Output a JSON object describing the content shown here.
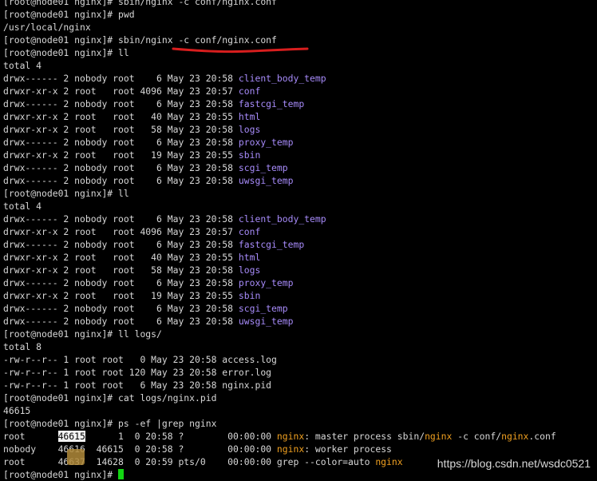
{
  "terminal": {
    "lines": [
      [
        {
          "t": "[root@node01 nginx]# sbin/nginx -c conf/nginx.conf"
        }
      ],
      [
        {
          "t": "[root@node01 nginx]# pwd"
        }
      ],
      [
        {
          "t": "/usr/local/nginx"
        }
      ],
      [
        {
          "t": "[root@node01 nginx]# sbin/nginx -c conf/nginx.conf"
        }
      ],
      [
        {
          "t": "[root@node01 nginx]# ll"
        }
      ],
      [
        {
          "t": "total 4"
        }
      ],
      [
        {
          "t": "drwx------ 2 nobody root    6 May 23 20:58 "
        },
        {
          "t": "client_body_temp",
          "c": "dir"
        }
      ],
      [
        {
          "t": "drwxr-xr-x 2 root   root 4096 May 23 20:57 "
        },
        {
          "t": "conf",
          "c": "dir"
        }
      ],
      [
        {
          "t": "drwx------ 2 nobody root    6 May 23 20:58 "
        },
        {
          "t": "fastcgi_temp",
          "c": "dir"
        }
      ],
      [
        {
          "t": "drwxr-xr-x 2 root   root   40 May 23 20:55 "
        },
        {
          "t": "html",
          "c": "dir"
        }
      ],
      [
        {
          "t": "drwxr-xr-x 2 root   root   58 May 23 20:58 "
        },
        {
          "t": "logs",
          "c": "dir"
        }
      ],
      [
        {
          "t": "drwx------ 2 nobody root    6 May 23 20:58 "
        },
        {
          "t": "proxy_temp",
          "c": "dir"
        }
      ],
      [
        {
          "t": "drwxr-xr-x 2 root   root   19 May 23 20:55 "
        },
        {
          "t": "sbin",
          "c": "dir"
        }
      ],
      [
        {
          "t": "drwx------ 2 nobody root    6 May 23 20:58 "
        },
        {
          "t": "scgi_temp",
          "c": "dir"
        }
      ],
      [
        {
          "t": "drwx------ 2 nobody root    6 May 23 20:58 "
        },
        {
          "t": "uwsgi_temp",
          "c": "dir"
        }
      ],
      [
        {
          "t": "[root@node01 nginx]# ll"
        }
      ],
      [
        {
          "t": "total 4"
        }
      ],
      [
        {
          "t": "drwx------ 2 nobody root    6 May 23 20:58 "
        },
        {
          "t": "client_body_temp",
          "c": "dir"
        }
      ],
      [
        {
          "t": "drwxr-xr-x 2 root   root 4096 May 23 20:57 "
        },
        {
          "t": "conf",
          "c": "dir"
        }
      ],
      [
        {
          "t": "drwx------ 2 nobody root    6 May 23 20:58 "
        },
        {
          "t": "fastcgi_temp",
          "c": "dir"
        }
      ],
      [
        {
          "t": "drwxr-xr-x 2 root   root   40 May 23 20:55 "
        },
        {
          "t": "html",
          "c": "dir"
        }
      ],
      [
        {
          "t": "drwxr-xr-x 2 root   root   58 May 23 20:58 "
        },
        {
          "t": "logs",
          "c": "dir"
        }
      ],
      [
        {
          "t": "drwx------ 2 nobody root    6 May 23 20:58 "
        },
        {
          "t": "proxy_temp",
          "c": "dir"
        }
      ],
      [
        {
          "t": "drwxr-xr-x 2 root   root   19 May 23 20:55 "
        },
        {
          "t": "sbin",
          "c": "dir"
        }
      ],
      [
        {
          "t": "drwx------ 2 nobody root    6 May 23 20:58 "
        },
        {
          "t": "scgi_temp",
          "c": "dir"
        }
      ],
      [
        {
          "t": "drwx------ 2 nobody root    6 May 23 20:58 "
        },
        {
          "t": "uwsgi_temp",
          "c": "dir"
        }
      ],
      [
        {
          "t": "[root@node01 nginx]# ll logs/"
        }
      ],
      [
        {
          "t": "total 8"
        }
      ],
      [
        {
          "t": "-rw-r--r-- 1 root root   0 May 23 20:58 access.log"
        }
      ],
      [
        {
          "t": "-rw-r--r-- 1 root root 120 May 23 20:58 error.log"
        }
      ],
      [
        {
          "t": "-rw-r--r-- 1 root root   6 May 23 20:58 nginx.pid"
        }
      ],
      [
        {
          "t": "[root@node01 nginx]# cat logs/nginx.pid"
        }
      ],
      [
        {
          "t": "46615"
        }
      ],
      [
        {
          "t": "[root@node01 nginx]# ps -ef |grep nginx"
        }
      ],
      [
        {
          "t": "root      "
        },
        {
          "t": "46615",
          "c": "pidbox"
        },
        {
          "t": "      1  0 20:58 ?        00:00:00 "
        },
        {
          "t": "nginx",
          "c": "hl"
        },
        {
          "t": ": master process sbin/"
        },
        {
          "t": "nginx",
          "c": "hl"
        },
        {
          "t": " -c conf/"
        },
        {
          "t": "nginx",
          "c": "hl"
        },
        {
          "t": ".conf"
        }
      ],
      [
        {
          "t": "nobody    46616  46615  0 20:58 ?        00:00:00 "
        },
        {
          "t": "nginx",
          "c": "hl"
        },
        {
          "t": ": worker process"
        }
      ],
      [
        {
          "t": "root      46637  14628  0 20:59 pts/0    00:00:00 grep --color=auto "
        },
        {
          "t": "nginx",
          "c": "hl"
        }
      ],
      [
        {
          "t": "[root@node01 nginx]# "
        },
        {
          "t": "",
          "c": "cursor"
        }
      ]
    ]
  },
  "watermark": {
    "text": "https://blog.csdn.net/wsdc0521"
  },
  "colors": {
    "background": "#000000",
    "text": "#d8d8d8",
    "directory": "#a78bfa",
    "match_highlight": "#f0a020",
    "cursor": "#12d612",
    "annotation": "#d81e1e"
  }
}
